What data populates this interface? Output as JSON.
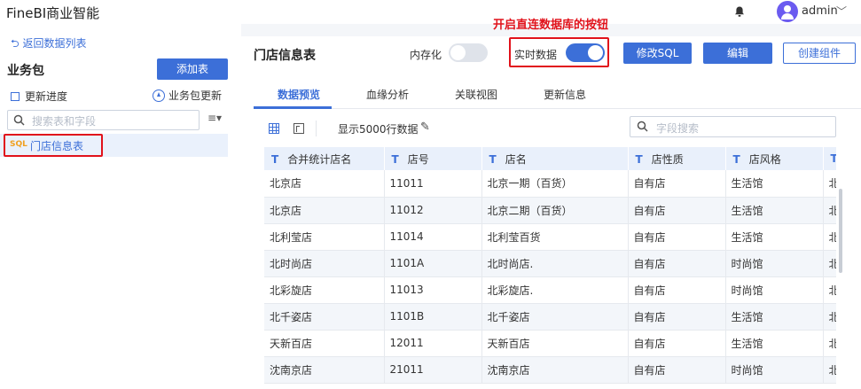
{
  "app": {
    "title": "FineBI商业智能",
    "user": "admin"
  },
  "sidebar": {
    "back_label": "返回数据列表",
    "package_title": "业务包",
    "add_table_label": "添加表",
    "update_progress_label": "更新进度",
    "package_update_label": "业务包更新",
    "search_placeholder": "搜索表和字段",
    "table_item": {
      "badge": "SQL",
      "name": "门店信息表"
    }
  },
  "main": {
    "table_title": "门店信息表",
    "memory_label": "内存化",
    "memory_enabled": false,
    "realtime_label": "实时数据",
    "realtime_enabled": true,
    "annotation": "开启直连数据库的按钮",
    "buttons": {
      "edit_sql": "修改SQL",
      "edit": "编辑",
      "create_component": "创建组件"
    },
    "tabs": [
      "数据预览",
      "血缘分析",
      "关联视图",
      "更新信息"
    ],
    "active_tab": "数据预览",
    "show_rows_label": "显示5000行数据",
    "field_search_placeholder": "字段搜索"
  },
  "grid": {
    "columns": [
      "合并统计店名",
      "店号",
      "店名",
      "店性质",
      "店风格",
      ""
    ],
    "column_type": "T",
    "rows": [
      [
        "北京店",
        "11011",
        "北京一期（百货）",
        "自有店",
        "生活馆",
        "北"
      ],
      [
        "北京店",
        "11012",
        "北京二期（百货）",
        "自有店",
        "生活馆",
        "北"
      ],
      [
        "北利莹店",
        "11014",
        "北利莹百货",
        "自有店",
        "生活馆",
        "北"
      ],
      [
        "北时尚店",
        "1101A",
        "北时尚店.",
        "自有店",
        "时尚馆",
        "北"
      ],
      [
        "北彩旋店",
        "11013",
        "北彩旋店.",
        "自有店",
        "时尚馆",
        "北"
      ],
      [
        "北千姿店",
        "1101B",
        "北千姿店",
        "自有店",
        "生活馆",
        "北"
      ],
      [
        "天新百店",
        "12011",
        "天新百店",
        "自有店",
        "生活馆",
        "北"
      ],
      [
        "沈南京店",
        "21011",
        "沈南京店",
        "自有店",
        "时尚馆",
        "北"
      ]
    ]
  },
  "colors": {
    "accent": "#3c6fd8",
    "highlight": "#e1121b",
    "header_bg": "#e9f0fb"
  }
}
